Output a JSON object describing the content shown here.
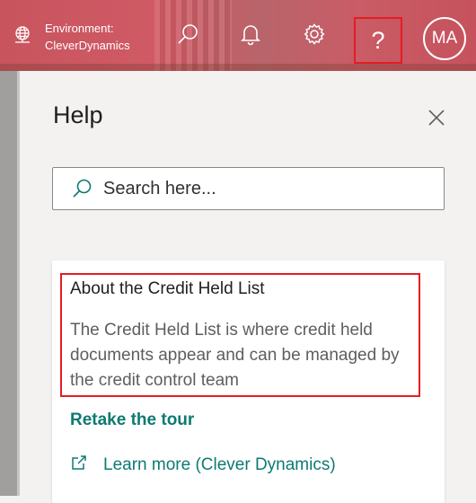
{
  "topbar": {
    "environment_label": "Environment:",
    "environment_name": "CleverDynamics",
    "help_glyph": "?",
    "avatar_initials": "MA",
    "icons": [
      "globe-icon",
      "search-icon",
      "bell-icon",
      "gear-icon",
      "help-icon"
    ],
    "brand_color": "#c8545e",
    "highlight_color": "#e51c23"
  },
  "help_panel": {
    "title": "Help",
    "search": {
      "placeholder": "Search here...",
      "value": ""
    },
    "card": {
      "title": "About the Credit Held List",
      "description": "The Credit Held List is where credit held documents appear and can be managed by the credit control team",
      "retake_tour_label": "Retake the tour",
      "learn_more_label": "Learn more (Clever Dynamics)"
    },
    "link_color": "#0e7a71"
  }
}
